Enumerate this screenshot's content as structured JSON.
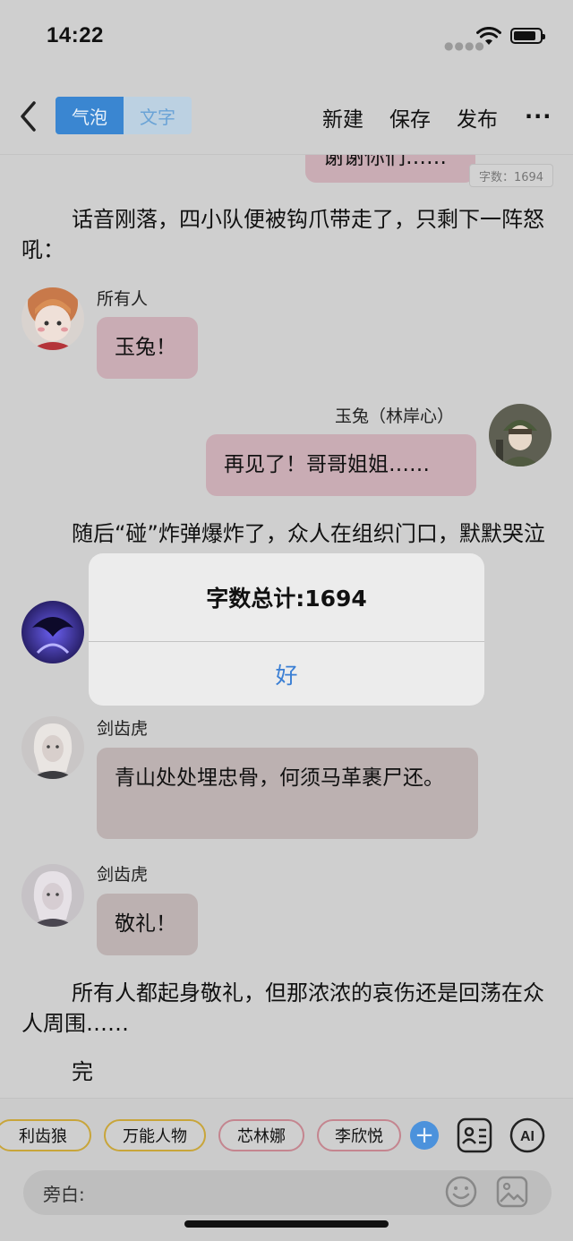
{
  "status": {
    "time": "14:22"
  },
  "nav": {
    "segments": [
      "气泡",
      "文字"
    ],
    "actions": [
      "新建",
      "保存",
      "发布"
    ],
    "more": "···"
  },
  "word_count_badge": "字数：1694",
  "top_bubble_text": "谢谢你们……",
  "paragraphs": [
    "话音刚落，四小队便被钩爪带走了，只剩下一阵怒吼：",
    "随后“碰”炸弹爆炸了，众人在组织门口，默默哭泣",
    "所有人都起身敬礼，但那浓浓的哀伤还是回荡在众人周围……",
    "完"
  ],
  "messages": [
    {
      "name": "所有人",
      "text": "玉兔！"
    },
    {
      "name": "玉兔（林岸心）",
      "text": "再见了！哥哥姐姐……"
    },
    {
      "name": "剑齿虎",
      "text": "青山处处埋忠骨，何须马革裹尸还。"
    },
    {
      "name": "剑齿虎",
      "text": "敬礼！"
    }
  ],
  "alert": {
    "title": "字数总计:1694",
    "ok": "好"
  },
  "characters": [
    "利齿狼",
    "万能人物",
    "芯林娜",
    "李欣悦"
  ],
  "input": {
    "label": "旁白:"
  },
  "colors": {
    "accent": "#3a86d1",
    "bubble_pink": "#c9acb4",
    "bubble_taupe": "#bcb1b1"
  }
}
